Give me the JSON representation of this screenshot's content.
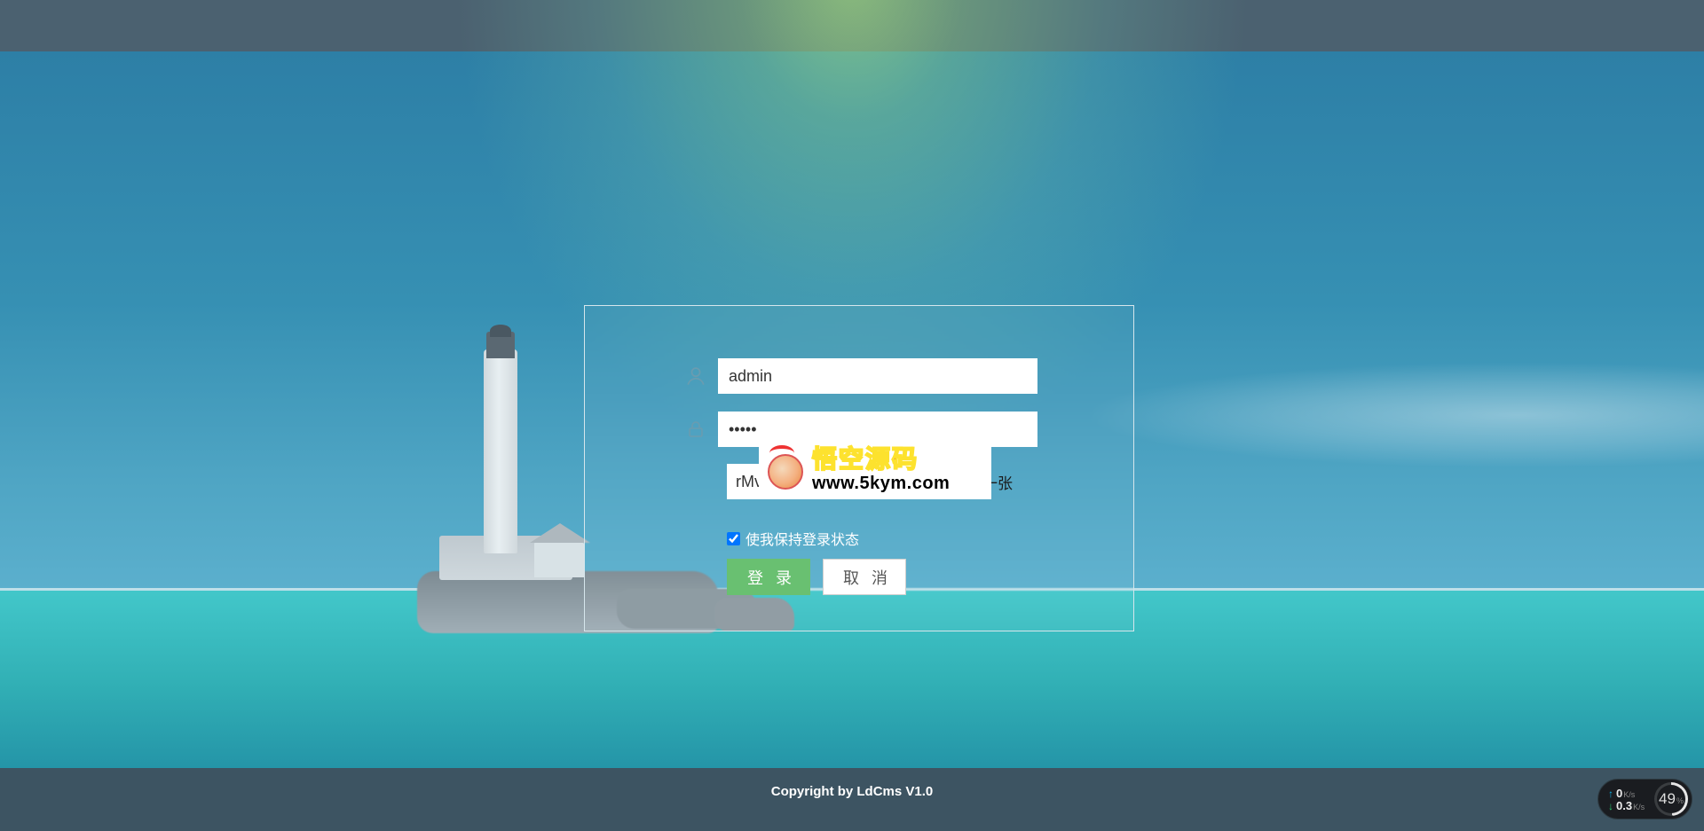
{
  "form": {
    "username_value": "admin",
    "password_value": "•••••",
    "captcha_value": "rMv",
    "captcha_hint": "不清，换一张",
    "remember_label": "使我保持登录状态",
    "login_button": "登录",
    "cancel_button": "取消"
  },
  "watermark": {
    "brand": "悟空源码",
    "url": "www.5kym.com"
  },
  "footer": {
    "copyright": "Copyright by LdCms V1.0"
  },
  "net_widget": {
    "upload_value": "0",
    "upload_unit": "K/s",
    "download_value": "0.3",
    "download_unit": "K/s",
    "cpu_percent": "49",
    "cpu_unit": "%"
  },
  "colors": {
    "login_btn": "#69c071",
    "brand_red": "#e11b22"
  }
}
